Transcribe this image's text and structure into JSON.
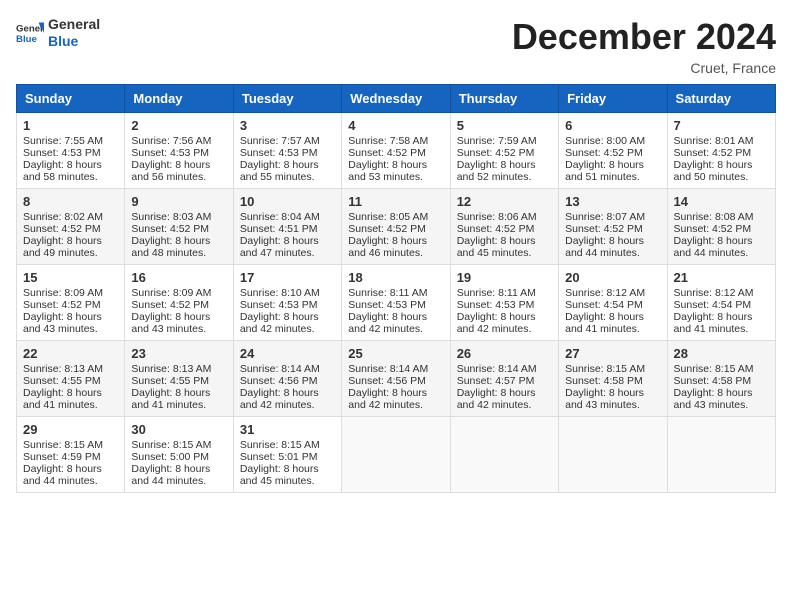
{
  "header": {
    "logo_general": "General",
    "logo_blue": "Blue",
    "month": "December 2024",
    "location": "Cruet, France"
  },
  "weekdays": [
    "Sunday",
    "Monday",
    "Tuesday",
    "Wednesday",
    "Thursday",
    "Friday",
    "Saturday"
  ],
  "weeks": [
    [
      {
        "day": "1",
        "lines": [
          "Sunrise: 7:55 AM",
          "Sunset: 4:53 PM",
          "Daylight: 8 hours",
          "and 58 minutes."
        ]
      },
      {
        "day": "2",
        "lines": [
          "Sunrise: 7:56 AM",
          "Sunset: 4:53 PM",
          "Daylight: 8 hours",
          "and 56 minutes."
        ]
      },
      {
        "day": "3",
        "lines": [
          "Sunrise: 7:57 AM",
          "Sunset: 4:53 PM",
          "Daylight: 8 hours",
          "and 55 minutes."
        ]
      },
      {
        "day": "4",
        "lines": [
          "Sunrise: 7:58 AM",
          "Sunset: 4:52 PM",
          "Daylight: 8 hours",
          "and 53 minutes."
        ]
      },
      {
        "day": "5",
        "lines": [
          "Sunrise: 7:59 AM",
          "Sunset: 4:52 PM",
          "Daylight: 8 hours",
          "and 52 minutes."
        ]
      },
      {
        "day": "6",
        "lines": [
          "Sunrise: 8:00 AM",
          "Sunset: 4:52 PM",
          "Daylight: 8 hours",
          "and 51 minutes."
        ]
      },
      {
        "day": "7",
        "lines": [
          "Sunrise: 8:01 AM",
          "Sunset: 4:52 PM",
          "Daylight: 8 hours",
          "and 50 minutes."
        ]
      }
    ],
    [
      {
        "day": "8",
        "lines": [
          "Sunrise: 8:02 AM",
          "Sunset: 4:52 PM",
          "Daylight: 8 hours",
          "and 49 minutes."
        ]
      },
      {
        "day": "9",
        "lines": [
          "Sunrise: 8:03 AM",
          "Sunset: 4:52 PM",
          "Daylight: 8 hours",
          "and 48 minutes."
        ]
      },
      {
        "day": "10",
        "lines": [
          "Sunrise: 8:04 AM",
          "Sunset: 4:51 PM",
          "Daylight: 8 hours",
          "and 47 minutes."
        ]
      },
      {
        "day": "11",
        "lines": [
          "Sunrise: 8:05 AM",
          "Sunset: 4:52 PM",
          "Daylight: 8 hours",
          "and 46 minutes."
        ]
      },
      {
        "day": "12",
        "lines": [
          "Sunrise: 8:06 AM",
          "Sunset: 4:52 PM",
          "Daylight: 8 hours",
          "and 45 minutes."
        ]
      },
      {
        "day": "13",
        "lines": [
          "Sunrise: 8:07 AM",
          "Sunset: 4:52 PM",
          "Daylight: 8 hours",
          "and 44 minutes."
        ]
      },
      {
        "day": "14",
        "lines": [
          "Sunrise: 8:08 AM",
          "Sunset: 4:52 PM",
          "Daylight: 8 hours",
          "and 44 minutes."
        ]
      }
    ],
    [
      {
        "day": "15",
        "lines": [
          "Sunrise: 8:09 AM",
          "Sunset: 4:52 PM",
          "Daylight: 8 hours",
          "and 43 minutes."
        ]
      },
      {
        "day": "16",
        "lines": [
          "Sunrise: 8:09 AM",
          "Sunset: 4:52 PM",
          "Daylight: 8 hours",
          "and 43 minutes."
        ]
      },
      {
        "day": "17",
        "lines": [
          "Sunrise: 8:10 AM",
          "Sunset: 4:53 PM",
          "Daylight: 8 hours",
          "and 42 minutes."
        ]
      },
      {
        "day": "18",
        "lines": [
          "Sunrise: 8:11 AM",
          "Sunset: 4:53 PM",
          "Daylight: 8 hours",
          "and 42 minutes."
        ]
      },
      {
        "day": "19",
        "lines": [
          "Sunrise: 8:11 AM",
          "Sunset: 4:53 PM",
          "Daylight: 8 hours",
          "and 42 minutes."
        ]
      },
      {
        "day": "20",
        "lines": [
          "Sunrise: 8:12 AM",
          "Sunset: 4:54 PM",
          "Daylight: 8 hours",
          "and 41 minutes."
        ]
      },
      {
        "day": "21",
        "lines": [
          "Sunrise: 8:12 AM",
          "Sunset: 4:54 PM",
          "Daylight: 8 hours",
          "and 41 minutes."
        ]
      }
    ],
    [
      {
        "day": "22",
        "lines": [
          "Sunrise: 8:13 AM",
          "Sunset: 4:55 PM",
          "Daylight: 8 hours",
          "and 41 minutes."
        ]
      },
      {
        "day": "23",
        "lines": [
          "Sunrise: 8:13 AM",
          "Sunset: 4:55 PM",
          "Daylight: 8 hours",
          "and 41 minutes."
        ]
      },
      {
        "day": "24",
        "lines": [
          "Sunrise: 8:14 AM",
          "Sunset: 4:56 PM",
          "Daylight: 8 hours",
          "and 42 minutes."
        ]
      },
      {
        "day": "25",
        "lines": [
          "Sunrise: 8:14 AM",
          "Sunset: 4:56 PM",
          "Daylight: 8 hours",
          "and 42 minutes."
        ]
      },
      {
        "day": "26",
        "lines": [
          "Sunrise: 8:14 AM",
          "Sunset: 4:57 PM",
          "Daylight: 8 hours",
          "and 42 minutes."
        ]
      },
      {
        "day": "27",
        "lines": [
          "Sunrise: 8:15 AM",
          "Sunset: 4:58 PM",
          "Daylight: 8 hours",
          "and 43 minutes."
        ]
      },
      {
        "day": "28",
        "lines": [
          "Sunrise: 8:15 AM",
          "Sunset: 4:58 PM",
          "Daylight: 8 hours",
          "and 43 minutes."
        ]
      }
    ],
    [
      {
        "day": "29",
        "lines": [
          "Sunrise: 8:15 AM",
          "Sunset: 4:59 PM",
          "Daylight: 8 hours",
          "and 44 minutes."
        ]
      },
      {
        "day": "30",
        "lines": [
          "Sunrise: 8:15 AM",
          "Sunset: 5:00 PM",
          "Daylight: 8 hours",
          "and 44 minutes."
        ]
      },
      {
        "day": "31",
        "lines": [
          "Sunrise: 8:15 AM",
          "Sunset: 5:01 PM",
          "Daylight: 8 hours",
          "and 45 minutes."
        ]
      },
      null,
      null,
      null,
      null
    ]
  ]
}
